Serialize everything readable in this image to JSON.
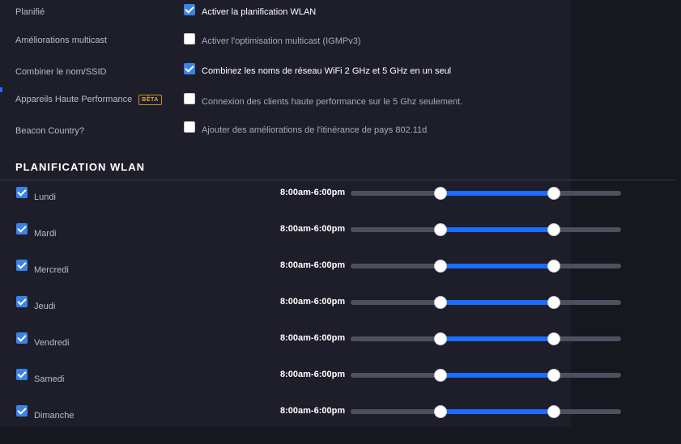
{
  "options": [
    {
      "label": "Planifié",
      "checked": true,
      "text": "Activer la planification WLAN"
    },
    {
      "label": "Améliorations multicast",
      "checked": false,
      "text": "Activer l'optimisation multicast (IGMPv3)"
    },
    {
      "label": "Combiner le nom/SSID",
      "checked": true,
      "text": "Combinez les noms de réseau WiFi 2 GHz et 5 GHz en un seul"
    },
    {
      "label": "Appareils Haute Performance",
      "badge": "BÊTA",
      "checked": false,
      "text": "Connexion des clients haute performance sur le 5 Ghz seulement."
    },
    {
      "label": "Beacon Country?",
      "checked": false,
      "text": "Ajouter des améliorations de l'itinérance de pays 802.11d"
    }
  ],
  "schedule": {
    "title": "PLANIFICATION WLAN",
    "days": [
      {
        "name": "Lundi",
        "checked": true,
        "range": "8:00am-6:00pm",
        "start": 0.3333,
        "end": 0.75
      },
      {
        "name": "Mardi",
        "checked": true,
        "range": "8:00am-6:00pm",
        "start": 0.3333,
        "end": 0.75
      },
      {
        "name": "Mercredi",
        "checked": true,
        "range": "8:00am-6:00pm",
        "start": 0.3333,
        "end": 0.75
      },
      {
        "name": "Jeudi",
        "checked": true,
        "range": "8:00am-6:00pm",
        "start": 0.3333,
        "end": 0.75
      },
      {
        "name": "Vendredi",
        "checked": true,
        "range": "8:00am-6:00pm",
        "start": 0.3333,
        "end": 0.75
      },
      {
        "name": "Samedi",
        "checked": true,
        "range": "8:00am-6:00pm",
        "start": 0.3333,
        "end": 0.75
      },
      {
        "name": "Dimanche",
        "checked": true,
        "range": "8:00am-6:00pm",
        "start": 0.3333,
        "end": 0.75
      }
    ]
  },
  "colors": {
    "accent": "#1a6dff",
    "checkbox": "#3b82e8",
    "badge": "#e2a93c"
  }
}
